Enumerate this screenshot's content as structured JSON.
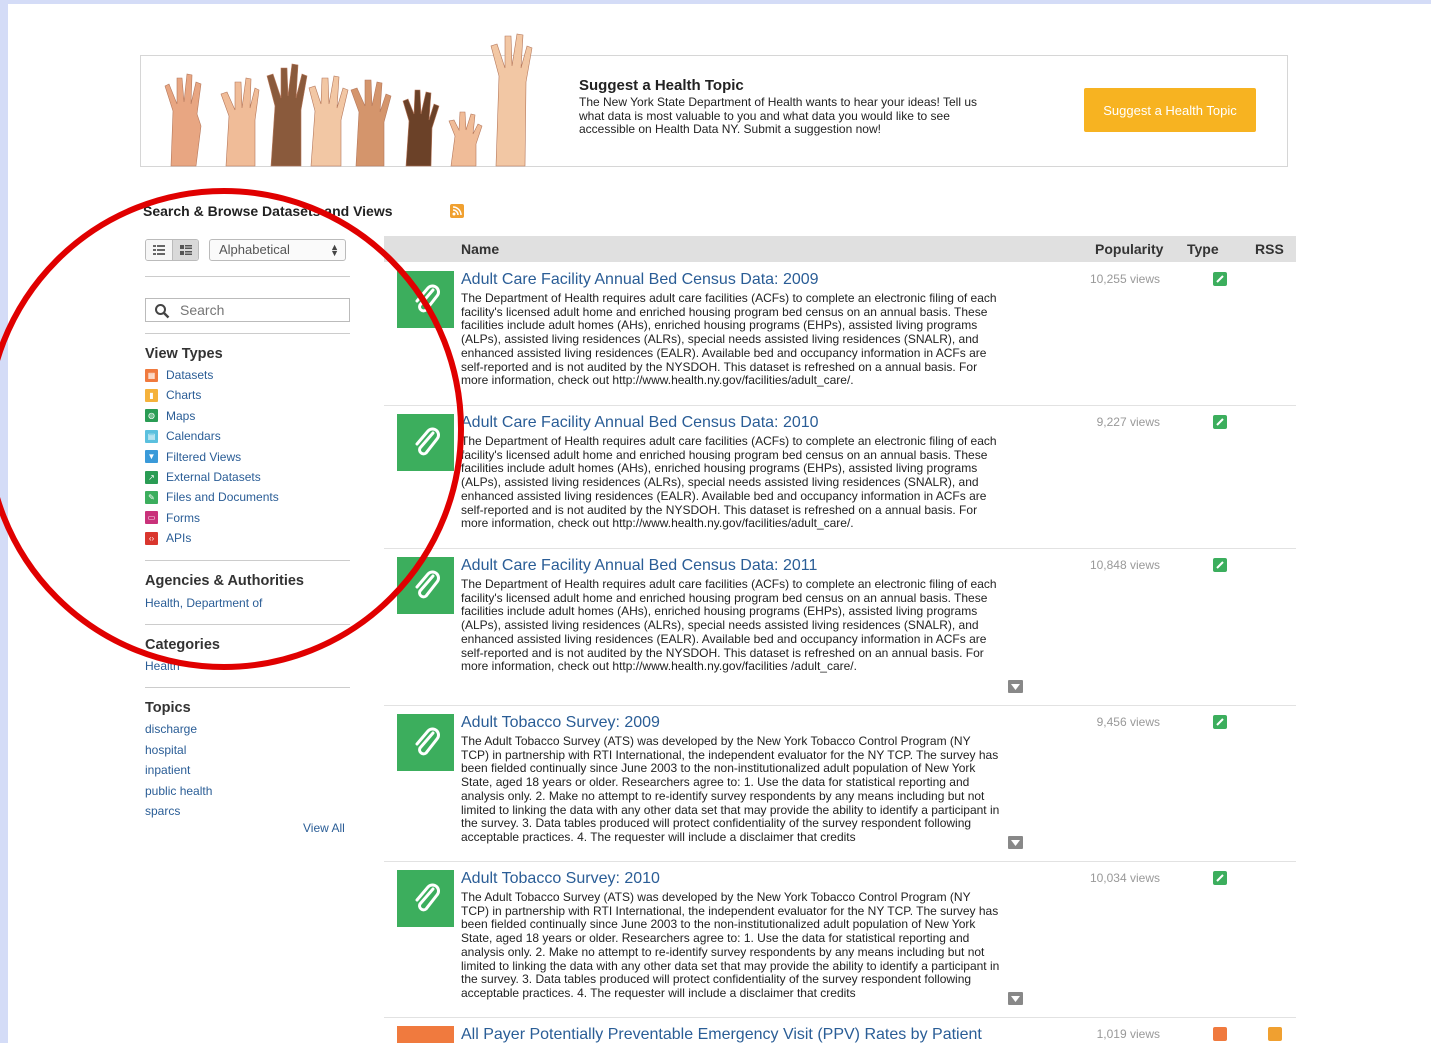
{
  "banner": {
    "title": "Suggest a Health Topic",
    "text": "The New York State Department of Health wants to hear your ideas! Tell us what data is most valuable to you and what data you would like to see accessible on Health Data NY. Submit a suggestion now!",
    "button_label": "Suggest a Health Topic"
  },
  "section_title": "Search & Browse Datasets and Views",
  "sidebar": {
    "sort_value": "Alphabetical",
    "search_placeholder": "Search",
    "view_types_heading": "View Types",
    "view_types": [
      {
        "label": "Datasets",
        "icon": "table-icon",
        "color": "#f07a3e"
      },
      {
        "label": "Charts",
        "icon": "chart-icon",
        "color": "#f5b23b"
      },
      {
        "label": "Maps",
        "icon": "globe-icon",
        "color": "#2a9c54"
      },
      {
        "label": "Calendars",
        "icon": "calendar-icon",
        "color": "#5bc0de"
      },
      {
        "label": "Filtered Views",
        "icon": "filter-icon",
        "color": "#3a9ad9"
      },
      {
        "label": "External Datasets",
        "icon": "external-link-icon",
        "color": "#2a9c54"
      },
      {
        "label": "Files and Documents",
        "icon": "paperclip-icon",
        "color": "#3cae5d"
      },
      {
        "label": "Forms",
        "icon": "form-icon",
        "color": "#c9327a"
      },
      {
        "label": "APIs",
        "icon": "code-icon",
        "color": "#d9362e"
      }
    ],
    "agencies_heading": "Agencies & Authorities",
    "agencies": [
      "Health, Department of"
    ],
    "categories_heading": "Categories",
    "categories": [
      "Health"
    ],
    "topics_heading": "Topics",
    "topics": [
      "discharge",
      "hospital",
      "inpatient",
      "public health",
      "sparcs"
    ],
    "view_all": "View All"
  },
  "table": {
    "headers": {
      "name": "Name",
      "popularity": "Popularity",
      "type": "Type",
      "rss": "RSS"
    },
    "rows": [
      {
        "title": "Adult Care Facility Annual Bed Census Data: 2009",
        "description": "The Department of Health requires adult care facilities (ACFs) to complete an electronic filing of each facility's licensed adult home and enriched housing program bed census on an annual basis. These facilities include adult homes (AHs), enriched housing programs (EHPs), assisted living programs (ALPs), assisted living residences (ALRs), special needs assisted living residences (SNALR), and enhanced assisted living residences (EALR). Available bed and occupancy information in ACFs are self-reported and is not audited by the NYSDOH. This dataset is refreshed on a annual basis. For more information, check out http://www.health.ny.gov/facilities/adult_care/.",
        "views": "10,255 views",
        "type_icon": "paperclip-icon"
      },
      {
        "title": "Adult Care Facility Annual Bed Census Data: 2010",
        "description": "The Department of Health requires adult care facilities (ACFs) to complete an electronic filing of each facility's licensed adult home and enriched housing program bed census on an annual basis. These facilities include adult homes (AHs), enriched housing programs (EHPs), assisted living programs (ALPs), assisted living residences (ALRs), special needs assisted living residences (SNALR), and enhanced assisted living residences (EALR). Available bed and occupancy information in ACFs are self-reported and is not audited by the NYSDOH. This dataset is refreshed on a annual basis. For more information, check out http://www.health.ny.gov/facilities/adult_care/.",
        "views": "9,227 views",
        "type_icon": "paperclip-icon"
      },
      {
        "title": "Adult Care Facility Annual Bed Census Data: 2011",
        "description": "The Department of Health requires adult care facilities (ACFs) to complete an electronic filing of each facility's licensed adult home and enriched housing program bed census on an annual basis. These facilities include adult homes (AHs), enriched housing programs (EHPs), assisted living programs (ALPs), assisted living residences (ALRs), special needs assisted living residences (SNALR), and enhanced assisted living residences (EALR). Available bed and occupancy information in ACFs are self-reported and is not audited by the NYSDOH. This dataset is refreshed on an annual basis. For more information, check out http://www.health.ny.gov/facilities /adult_care/.",
        "views": "10,848 views",
        "type_icon": "paperclip-icon"
      },
      {
        "title": "Adult Tobacco Survey: 2009",
        "description": "The Adult Tobacco Survey (ATS) was developed by the New York Tobacco Control Program (NY TCP) in partnership with RTI International, the independent evaluator for the NY TCP. The survey has been fielded continually since June 2003 to the non-institutionalized adult population of New York State, aged 18 years or older. Researchers agree to: 1. Use the data for statistical reporting and analysis only. 2. Make no attempt to re-identify survey respondents by any means including but not limited to linking the data with any other data set that may provide the ability to identify a participant in the survey. 3. Data tables produced will protect confidentiality of the survey respondent following acceptable practices. 4. The requester will include a disclaimer that credits",
        "views": "9,456 views",
        "type_icon": "paperclip-icon"
      },
      {
        "title": "Adult Tobacco Survey: 2010",
        "description": "The Adult Tobacco Survey (ATS) was developed by the New York Tobacco Control Program (NY TCP) in partnership with RTI International, the independent evaluator for the NY TCP. The survey has been fielded continually since June 2003 to the non-institutionalized adult population of New York State, aged 18 years or older. Researchers agree to: 1. Use the data for statistical reporting and analysis only. 2. Make no attempt to re-identify survey respondents by any means including but not limited to linking the data with any other data set that may provide the ability to identify a participant in the survey. 3. Data tables produced will protect confidentiality of the survey respondent following acceptable practices. 4. The requester will include a disclaimer that credits",
        "views": "10,034 views",
        "type_icon": "paperclip-icon"
      },
      {
        "title": "All Payer Potentially Preventable Emergency Visit (PPV) Rates by Patient",
        "description": "",
        "views": "1,019 views",
        "type_icon": "table-icon"
      }
    ]
  },
  "colors": {
    "accent": "#f7b321",
    "link": "#2a5d96",
    "file_green": "#3cae5d",
    "annotation_red": "#e00000"
  }
}
